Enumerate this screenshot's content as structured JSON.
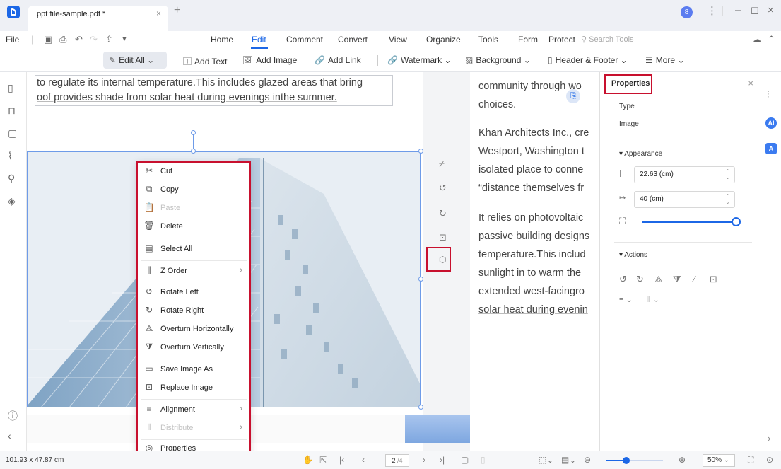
{
  "window": {
    "tab_title": "ppt file-sample.pdf *",
    "tab_close": "×",
    "tab_add": "+",
    "avatar_initial": "8",
    "more": "⋮",
    "minimize": "–",
    "maximize": "☐",
    "close": "×"
  },
  "menubar": {
    "file": "File",
    "items": [
      "Home",
      "Edit",
      "Comment",
      "Convert",
      "View",
      "Organize",
      "Tools",
      "Form",
      "Protect"
    ],
    "active": "Edit",
    "search_placeholder": "Search Tools"
  },
  "toolbar": {
    "edit_all": "Edit All",
    "add_text": "Add Text",
    "add_image": "Add Image",
    "add_link": "Add Link",
    "watermark": "Watermark",
    "background": "Background",
    "header_footer": "Header & Footer",
    "more": "More"
  },
  "document": {
    "left_lines": [
      "to regulate its internal temperature.This includes glazed areas that bring",
      "oof provides shade from solar heat during evenings inthe summer."
    ],
    "right_lines": [
      "community through wo",
      "choices.",
      "Khan Architects Inc., cre",
      "Westport, Washington t",
      "isolated place to conne",
      "“distance themselves fr",
      "It relies on photovoltaic",
      "passive building designs",
      "temperature.This includ",
      "sunlight in to warm the",
      "extended west-facingro",
      "solar heat during evenin"
    ]
  },
  "context_menu": {
    "items": [
      {
        "label": "Cut",
        "icon": "scissors-icon",
        "glyph": "✂",
        "disabled": false
      },
      {
        "label": "Copy",
        "icon": "copy-icon",
        "glyph": "⧉",
        "disabled": false
      },
      {
        "label": "Paste",
        "icon": "paste-icon",
        "glyph": "📋",
        "disabled": true
      },
      {
        "label": "Delete",
        "icon": "trash-icon",
        "glyph": "🗑",
        "disabled": false
      },
      {
        "label": "Select All",
        "icon": "select-all-icon",
        "glyph": "▤",
        "disabled": false
      },
      {
        "label": "Z Order",
        "icon": "z-order-icon",
        "glyph": "⫼",
        "disabled": false,
        "submenu": true
      },
      {
        "label": "Rotate Left",
        "icon": "rotate-left-icon",
        "glyph": "↺",
        "disabled": false
      },
      {
        "label": "Rotate Right",
        "icon": "rotate-right-icon",
        "glyph": "↻",
        "disabled": false
      },
      {
        "label": "Overturn Horizontally",
        "icon": "flip-horizontal-icon",
        "glyph": "⟁",
        "disabled": false
      },
      {
        "label": "Overturn Vertically",
        "icon": "flip-vertical-icon",
        "glyph": "⧩",
        "disabled": false
      },
      {
        "label": "Save Image As",
        "icon": "save-image-icon",
        "glyph": "▭",
        "disabled": false
      },
      {
        "label": "Replace Image",
        "icon": "replace-image-icon",
        "glyph": "⊡",
        "disabled": false
      },
      {
        "label": "Alignment",
        "icon": "alignment-icon",
        "glyph": "≡",
        "disabled": false,
        "submenu": true
      },
      {
        "label": "Distribute",
        "icon": "distribute-icon",
        "glyph": "⫴",
        "disabled": true,
        "submenu": true
      },
      {
        "label": "Properties",
        "icon": "properties-icon",
        "glyph": "◎",
        "disabled": false
      }
    ]
  },
  "properties": {
    "title": "Properties",
    "close": "×",
    "type_label": "Type",
    "type_value": "Image",
    "appearance": "Appearance",
    "height_value": "22.63 (cm)",
    "width_value": "40 (cm)",
    "opacity": 1.0,
    "actions": "Actions"
  },
  "rail": {
    "ai_label": "AI",
    "translate_label": "A"
  },
  "statusbar": {
    "dimensions": "101.93 x 47.87 cm",
    "page_current": "2",
    "page_total": "4",
    "zoom": "50%",
    "zoom_fraction": 0.35
  },
  "colors": {
    "accent": "#1c67e6",
    "highlight_box": "#c8102e",
    "selection": "#6e9be8"
  }
}
